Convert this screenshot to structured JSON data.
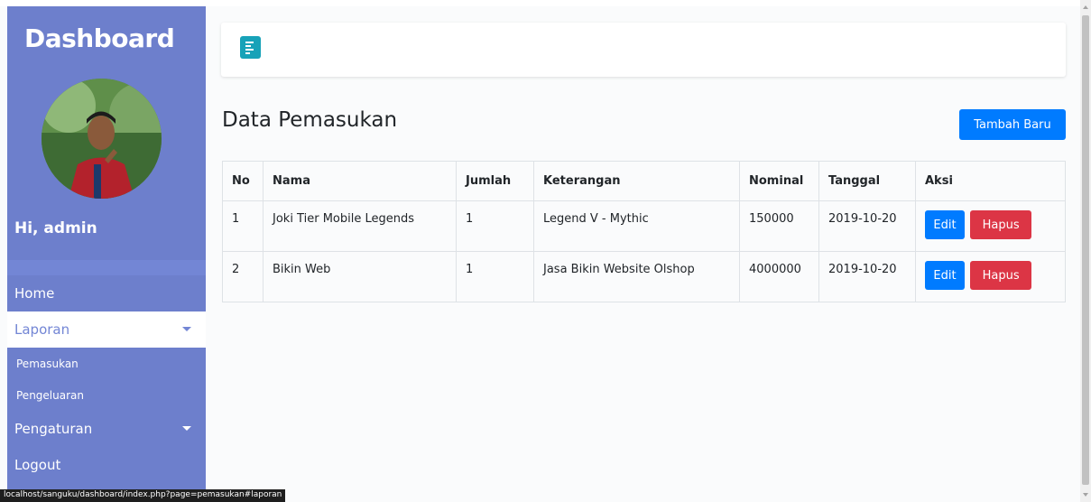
{
  "sidebar": {
    "brand": "Dashboard",
    "greeting": "Hi, admin",
    "menu": {
      "home": "Home",
      "laporan": "Laporan",
      "pemasukan": "Pemasukan",
      "pengeluaran": "Pengeluaran",
      "pengaturan": "Pengaturan",
      "logout": "Logout"
    }
  },
  "main": {
    "title": "Data Pemasukan",
    "add_button": "Tambah Baru",
    "table": {
      "headers": [
        "No",
        "Nama",
        "Jumlah",
        "Keterangan",
        "Nominal",
        "Tanggal",
        "Aksi"
      ],
      "rows": [
        {
          "no": "1",
          "nama": "Joki Tier Mobile Legends",
          "jumlah": "1",
          "keterangan": "Legend V - Mythic",
          "nominal": "150000",
          "tanggal": "2019-10-20",
          "edit": "Edit",
          "hapus": "Hapus"
        },
        {
          "no": "2",
          "nama": "Bikin Web",
          "jumlah": "1",
          "keterangan": "Jasa Bikin Website Olshop",
          "nominal": "4000000",
          "tanggal": "2019-10-20",
          "edit": "Edit",
          "hapus": "Hapus"
        }
      ]
    }
  },
  "status_bar": "localhost/sanguku/dashboard/index.php?page=pemasukan#laporan",
  "colors": {
    "sidebar": "#6d7fcc",
    "primary": "#007bff",
    "danger": "#dc3545",
    "info": "#17a2b8"
  }
}
